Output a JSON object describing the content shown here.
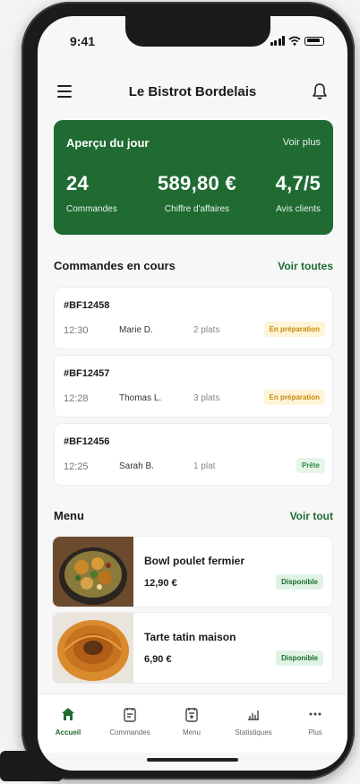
{
  "status": {
    "time": "9:41"
  },
  "header": {
    "title": "Le Bistrot Bordelais"
  },
  "overview": {
    "title": "Aperçu du jour",
    "more": "Voir plus",
    "stats": [
      {
        "value": "24",
        "label": "Commandes"
      },
      {
        "value": "589,80 €",
        "label": "Chiffre d'affaires"
      },
      {
        "value": "4,7/5",
        "label": "Avis clients"
      }
    ]
  },
  "orders": {
    "title": "Commandes en cours",
    "link": "Voir toutes",
    "items": [
      {
        "id": "#BF12458",
        "time": "12:30",
        "customer": "Marie D.",
        "plates": "2 plats",
        "status": "En préparation",
        "status_type": "prep"
      },
      {
        "id": "#BF12457",
        "time": "12:28",
        "customer": "Thomas L.",
        "plates": "3 plats",
        "status": "En préparation",
        "status_type": "prep"
      },
      {
        "id": "#BF12456",
        "time": "12:25",
        "customer": "Sarah B.",
        "plates": "1 plat",
        "status": "Prête",
        "status_type": "ready"
      }
    ]
  },
  "menu": {
    "title": "Menu",
    "link": "Voir tout",
    "items": [
      {
        "name": "Bowl poulet fermier",
        "price": "12,90 €",
        "status": "Disponible"
      },
      {
        "name": "Tarte tatin maison",
        "price": "6,90 €",
        "status": "Disponible"
      }
    ]
  },
  "tabs": [
    {
      "label": "Accueil",
      "icon": "home-icon",
      "active": true
    },
    {
      "label": "Commandes",
      "icon": "receipt-icon",
      "active": false
    },
    {
      "label": "Menu",
      "icon": "menu-book-icon",
      "active": false
    },
    {
      "label": "Statistiques",
      "icon": "chart-icon",
      "active": false
    },
    {
      "label": "Plus",
      "icon": "more-icon",
      "active": false
    }
  ],
  "colors": {
    "brand": "#1f6b32",
    "prep_bg": "#fff4d6",
    "prep_fg": "#c58a12",
    "ready_bg": "#e7f5e9",
    "ready_fg": "#2e8a43"
  }
}
